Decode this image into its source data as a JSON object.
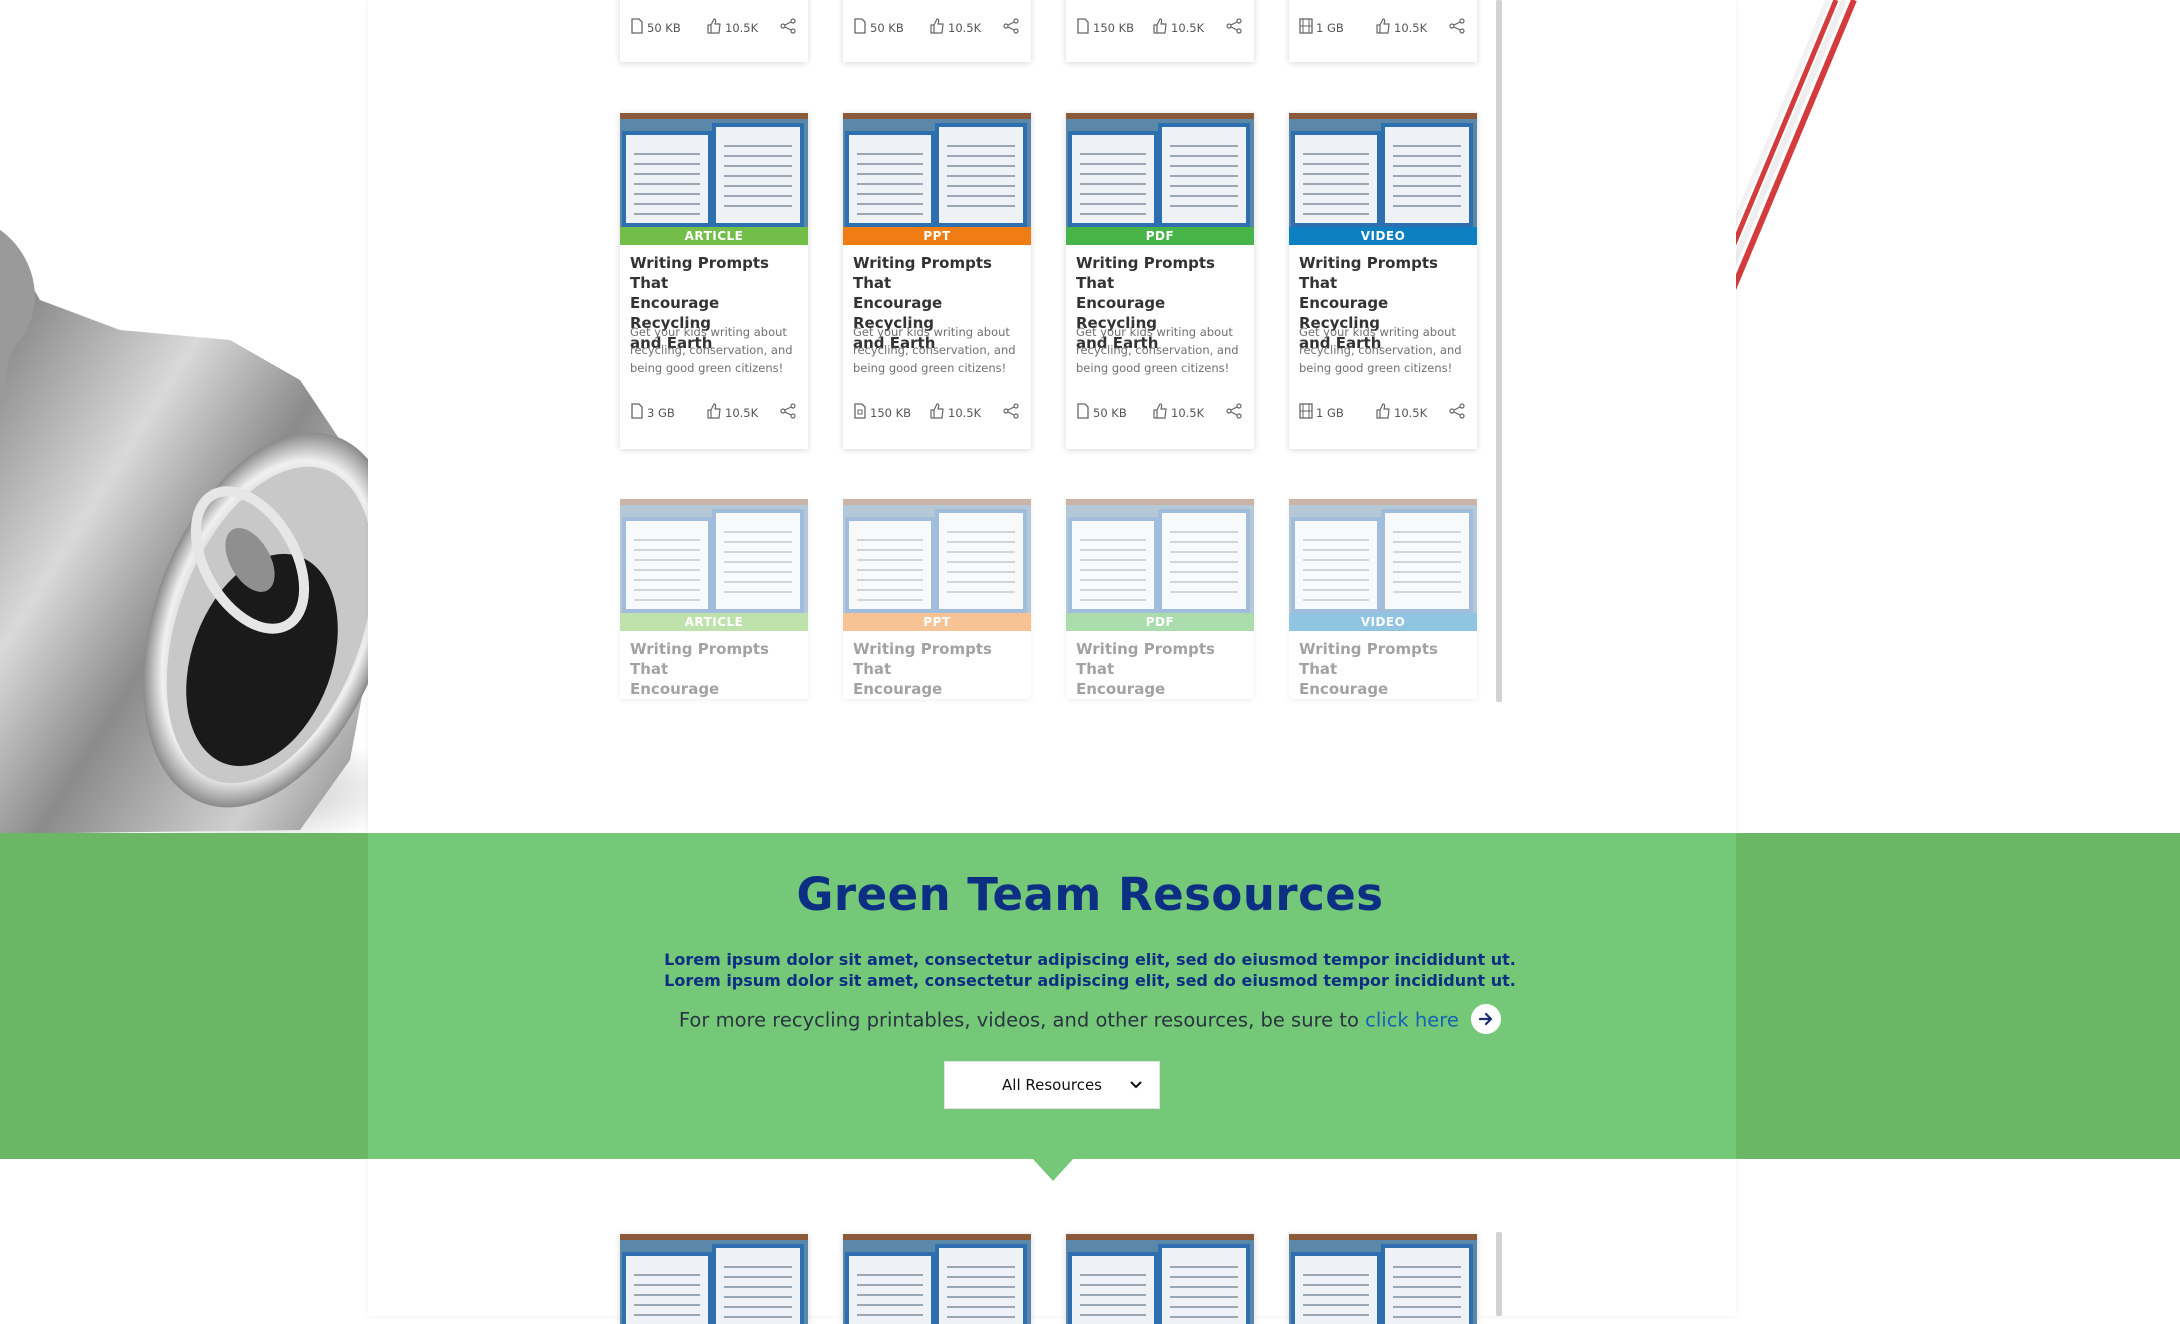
{
  "badge_colors": {
    "ARTICLE": "#72be49",
    "PPT": "#f07c14",
    "PDF": "#47b44a",
    "VIDEO": "#0c80c0"
  },
  "card_title": "Writing Prompts That Encourage Recycling and Earth",
  "card_title_lines": [
    "Writing Prompts That",
    "Encourage Recycling",
    "and Earth"
  ],
  "card_desc_lines": [
    "Get your kids writing about",
    "recycling, conservation, and",
    "being good green citizens!"
  ],
  "top_meta": [
    {
      "size": "50 KB",
      "likes": "10.5K",
      "icon": "document-icon"
    },
    {
      "size": "50 KB",
      "likes": "10.5K",
      "icon": "document-icon"
    },
    {
      "size": "150 KB",
      "likes": "10.5K",
      "icon": "document-icon"
    },
    {
      "size": "1 GB",
      "likes": "10.5K",
      "icon": "film-icon"
    }
  ],
  "row2": [
    {
      "type": "ARTICLE",
      "size": "3 GB",
      "likes": "10.5K",
      "icon": "document-icon"
    },
    {
      "type": "PPT",
      "size": "150 KB",
      "likes": "10.5K",
      "icon": "presentation-icon"
    },
    {
      "type": "PDF",
      "size": "50 KB",
      "likes": "10.5K",
      "icon": "document-icon"
    },
    {
      "type": "VIDEO",
      "size": "1 GB",
      "likes": "10.5K",
      "icon": "film-icon"
    }
  ],
  "row3": [
    {
      "type": "ARTICLE"
    },
    {
      "type": "PPT"
    },
    {
      "type": "PDF"
    },
    {
      "type": "VIDEO"
    }
  ],
  "section": {
    "title": "Green Team Resources",
    "lorem_1": "Lorem ipsum dolor sit amet, consectetur adipiscing elit, sed do eiusmod tempor incididunt ut.",
    "lorem_2": "Lorem ipsum dolor sit amet, consectetur adipiscing elit, sed do eiusmod tempor incididunt ut.",
    "more_text": "For more recycling printables, videos, and other resources, be sure to",
    "link_text": "click here",
    "dropdown_label": "All Resources"
  }
}
